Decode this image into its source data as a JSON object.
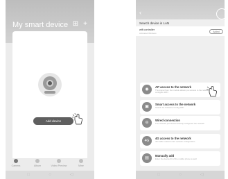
{
  "phone1": {
    "title": "My smart device",
    "add_device_label": "Add device",
    "tabs": [
      {
        "label": "Camera",
        "icon": "camera-icon",
        "active": true
      },
      {
        "label": "Album",
        "icon": "album-icon",
        "active": false
      },
      {
        "label": "Video Preview",
        "icon": "video-preview-icon",
        "active": false
      },
      {
        "label": "Mine",
        "icon": "mine-icon",
        "active": false
      }
    ]
  },
  "phone2": {
    "lan_label": "Search device in LAN",
    "lan_device": {
      "name": "wifi controller",
      "sub": "Activated Wireless",
      "add_label": "Added"
    },
    "options": [
      {
        "title": "AP access to the network",
        "desc": "The signal from the module allows you access to the network to configure WiFi",
        "icon": "wifi-icon"
      },
      {
        "title": "Smart access to the network",
        "desc": "Search for Software Config WiFi",
        "icon": "smart-icon"
      },
      {
        "title": "Wired connection",
        "desc": "The network port device directly configured the network",
        "icon": "wired-icon"
      },
      {
        "title": "4G access to the network",
        "desc": "4G traffic network card network configuration",
        "icon": "4g-icon"
      },
      {
        "title": "Manually add",
        "desc": "Enter the device ID of the mobile phone to add",
        "icon": "manual-icon"
      }
    ]
  },
  "colors": {
    "accent_gray": "#8a8a8a",
    "header_gray": "#c4c4c4",
    "background": "#efefef"
  }
}
